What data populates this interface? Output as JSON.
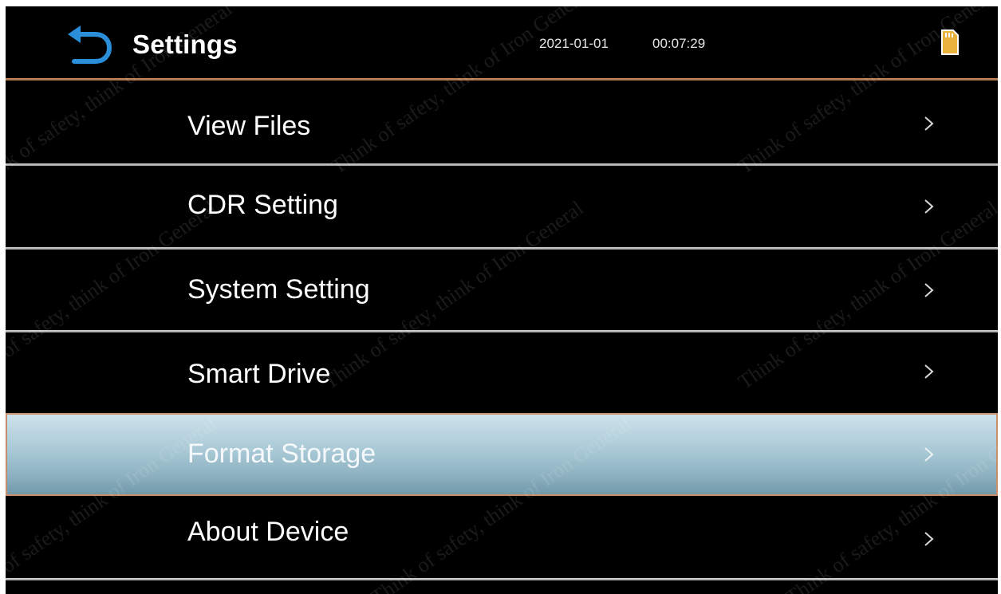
{
  "header": {
    "title": "Settings",
    "date": "2021-01-01",
    "time": "00:07:29",
    "back_icon": "back-arrow-icon",
    "storage_icon": "sd-card-icon"
  },
  "menu": {
    "items": [
      {
        "label": "View Files",
        "selected": false
      },
      {
        "label": "CDR Setting",
        "selected": false
      },
      {
        "label": "System Setting",
        "selected": false
      },
      {
        "label": "Smart Drive",
        "selected": false
      },
      {
        "label": "Format Storage",
        "selected": true
      },
      {
        "label": "About Device",
        "selected": false
      }
    ],
    "chevron": ">"
  },
  "watermark": {
    "text": "Think of safety, think of Iron General"
  },
  "colors": {
    "background": "#000000",
    "accent_blue": "#2a8fd8",
    "selected_row": "#a9c9d6",
    "header_divider": "#c88a5e",
    "sd_card": "#e8b23c"
  }
}
